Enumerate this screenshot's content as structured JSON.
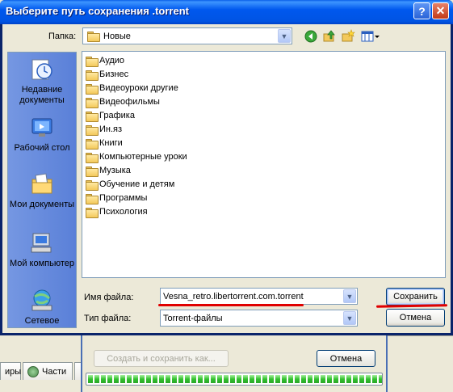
{
  "dialog": {
    "title": "Выберите путь сохранения .torrent",
    "help_glyph": "?",
    "close_glyph": "✕"
  },
  "location": {
    "label": "Папка:",
    "value": "Новые"
  },
  "places": [
    {
      "label": "Недавние документы",
      "icon": "recent-documents-icon"
    },
    {
      "label": "Рабочий стол",
      "icon": "desktop-icon"
    },
    {
      "label": "Мои документы",
      "icon": "my-documents-icon"
    },
    {
      "label": "Мой компьютер",
      "icon": "my-computer-icon"
    },
    {
      "label": "Сетевое",
      "icon": "network-icon"
    }
  ],
  "folders": [
    "Аудио",
    "Бизнес",
    "Видеоуроки другие",
    "Видеофильмы",
    "Графика",
    "Ин.яз",
    "Книги",
    "Компьютерные уроки",
    "Музыка",
    "Обучение и детям",
    "Программы",
    "Психология"
  ],
  "filename": {
    "label": "Имя файла:",
    "value": "Vesna_retro.libertorrent.com.torrent"
  },
  "filetype": {
    "label": "Тип файла:",
    "value": "Torrent-файлы"
  },
  "buttons": {
    "save": "Сохранить",
    "cancel": "Отмена"
  },
  "background": {
    "create_button": "Создать и сохранить как...",
    "cancel_button": "Отмена",
    "tab_left": "иры",
    "tab_parts": "Части",
    "progress_fraction": 1.0
  },
  "colors": {
    "title_bar": "#0054e3",
    "annotation_red": "#e00000",
    "places_bar": "#6e8edf"
  }
}
